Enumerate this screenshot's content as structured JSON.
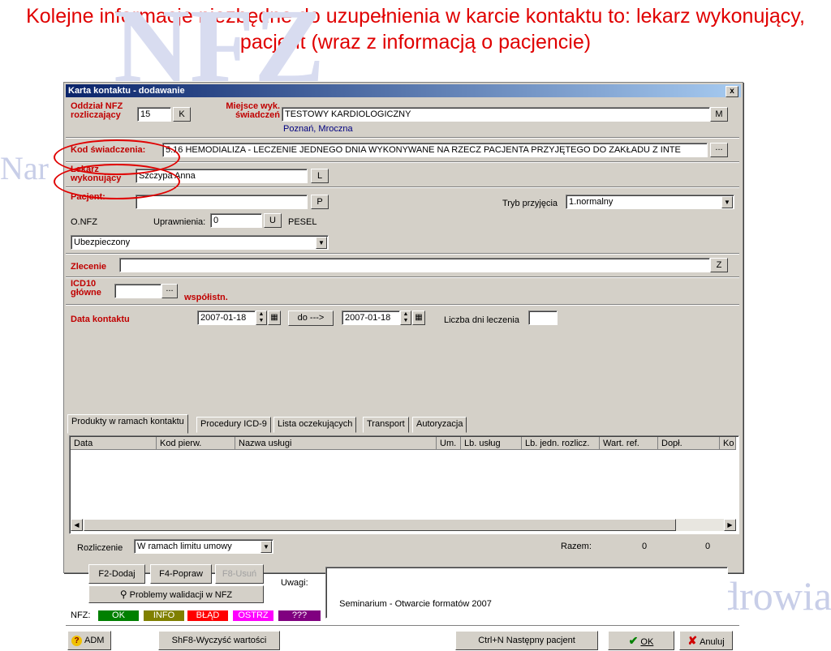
{
  "slide": {
    "title": "Kolejne informacje niezbędne do uzupełnienia w karcie kontaktu to: lekarz wykonujący, pacjent (wraz z informacją o pacjencie)",
    "footer": "Seminarium - Otwarcie formatów 2007",
    "watermark_left": "Nar",
    "watermark_bottom": "Narodowy Fundusz Zdrowia"
  },
  "window": {
    "title": "Karta kontaktu - dodawanie",
    "close_label": "x"
  },
  "form": {
    "oddzial_label": "Oddział NFZ rozliczający",
    "oddzial_value": "15",
    "oddzial_btn": "K",
    "miejsce_label": "Miejsce wyk. świadczeń",
    "miejsce_value": "TESTOWY KARDIOLOGICZNY",
    "miejsce_btn": "M",
    "miejsce_sub": "Poznań, Mroczna",
    "kod_label": "Kod świadczenia:",
    "kod_value": "5.16 HEMODIALIZA - LECZENIE JEDNEGO DNIA WYKONYWANE NA RZECZ PACJENTA PRZYJĘTEGO DO ZAKŁADU Z INTE",
    "kod_btn": "...",
    "lekarz_label": "Lekarz wykonujący",
    "lekarz_value": "Szczypa Anna",
    "lekarz_btn": "L",
    "pacjent_label": "Pacjent:",
    "pacjent_value": "",
    "pacjent_btn": "P",
    "tryb_label": "Tryb przyjęcia",
    "tryb_value": "1.normalny",
    "onfz_label": "O.NFZ",
    "uprawnienia_label": "Uprawnienia:",
    "uprawnienia_value": "0",
    "uprawnienia_btn": "U",
    "pesel_label": "PESEL",
    "ubezp_value": "Ubezpieczony",
    "zlecenie_label": "Zlecenie",
    "zlecenie_value": "",
    "zlecenie_btn": "Z",
    "icd_label": "ICD10 główne",
    "icd_value": "",
    "icd_btn": "...",
    "wspol_label": "współistn.",
    "data_label": "Data kontaktu",
    "date_from": "2007-01-18",
    "do_btn": "do --->",
    "date_to": "2007-01-18",
    "liczba_label": "Liczba dni leczenia",
    "liczba_value": ""
  },
  "tabs": [
    {
      "label": "Produkty w ramach kontaktu"
    },
    {
      "label": "Procedury ICD-9"
    },
    {
      "label": "Lista oczekujących"
    },
    {
      "label": "Transport"
    },
    {
      "label": "Autoryzacja"
    }
  ],
  "grid": {
    "columns": [
      "Data",
      "Kod pierw.",
      "Nazwa usługi",
      "Um.",
      "Lb. usług",
      "Lb. jedn. rozlicz.",
      "Wart. ref.",
      "Dopł.",
      "Ko"
    ]
  },
  "bottom": {
    "rozliczenie_label": "Rozliczenie",
    "rozliczenie_value": "W ramach limitu umowy",
    "razem_label": "Razem:",
    "razem_1": "0",
    "razem_2": "0",
    "f2_label": "F2-Dodaj",
    "f4_label": "F4-Popraw",
    "f8_label": "F8-Usuń",
    "uwagi_label": "Uwagi:",
    "problemy_label": "Problemy walidacji w NFZ",
    "nfz_label": "NFZ:",
    "status_ok": "OK",
    "status_info": "INFO",
    "status_blad": "BŁĄD",
    "status_ostrz": "OSTRZ",
    "status_q": "???",
    "adm_label": "ADM",
    "clear_label": "ShF8-Wyczyść wartości",
    "next_label": "Ctrl+N Następny pacjent",
    "ok_label": "OK",
    "cancel_label": "Anuluj"
  },
  "colors": {
    "title_red": "#e00000",
    "ok_green": "#008000",
    "info_olive": "#808000",
    "blad_red": "#ff0000",
    "ostrz_magenta": "#ff00ff",
    "q_purple": "#800080"
  }
}
